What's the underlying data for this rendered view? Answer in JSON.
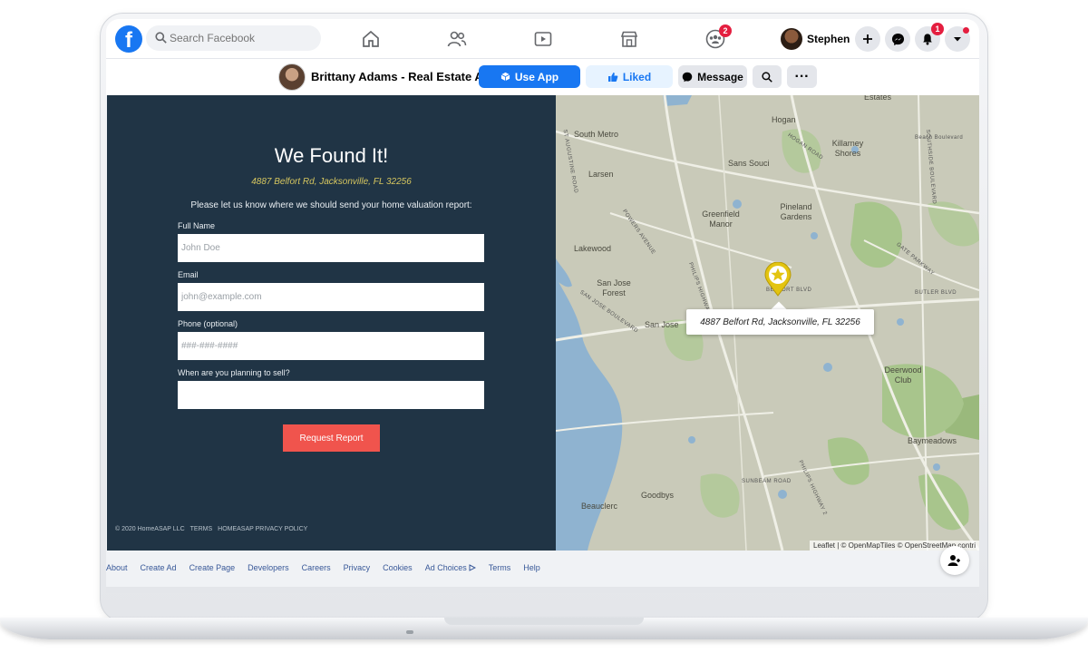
{
  "topnav": {
    "logo": "f",
    "search_placeholder": "Search Facebook",
    "groups_badge": "2",
    "user_name": "Stephen",
    "notifications_badge": "1",
    "brand_color": "#1877f2"
  },
  "page_header": {
    "page_name": "Brittany Adams - Real Estate A...",
    "use_app_label": "Use App",
    "liked_label": "Liked",
    "message_label": "Message",
    "more_label": "···"
  },
  "form": {
    "title": "We Found It!",
    "address": "4887 Belfort Rd, Jacksonville, FL 32256",
    "prompt": "Please let us know where we should send your home valuation report:",
    "fields": [
      {
        "label": "Full Name",
        "placeholder": "John Doe"
      },
      {
        "label": "Email",
        "placeholder": "john@example.com"
      },
      {
        "label": "Phone (optional)",
        "placeholder": "###-###-####"
      },
      {
        "label": "When are you planning to sell?",
        "placeholder": ""
      }
    ],
    "submit_label": "Request Report",
    "footer": {
      "copyright": "© 2020 HomeASAP LLC",
      "terms": "TERMS",
      "privacy": "HOMEASAP PRIVACY POLICY"
    },
    "background_color": "#203445",
    "accent_color": "#f0544d"
  },
  "map": {
    "popup_address": "4887 Belfort Rd, Jacksonville, FL 32256",
    "attribution": "Leaflet | © OpenMapTiles © OpenStreetMap contri",
    "places": [
      "South Metro",
      "Hogan",
      "Killarney Shores",
      "Larsen",
      "Sans Souci",
      "Greenfield Manor",
      "Pineland Gardens",
      "Lakewood",
      "San Jose Forest",
      "San Jose",
      "Deerwood Club",
      "Baymeadows",
      "Goodbys",
      "Beauclerc",
      "Estates",
      "Beach Boulevard"
    ],
    "roads": [
      "HOGAN ROAD",
      "ST AUGUSTINE ROAD",
      "POWERS AVENUE",
      "PHILIPS HIGHWAY",
      "SAN JOSE BOULEVARD",
      "BELFORT BLVD",
      "GATE PARKWAY",
      "BUTLER BLVD",
      "SUNBEAM ROAD",
      "SOUTHSIDE BOULEVARD",
      "PHILIPS HIGHWAY 2"
    ]
  },
  "footer_links": [
    "About",
    "Create Ad",
    "Create Page",
    "Developers",
    "Careers",
    "Privacy",
    "Cookies",
    "Ad Choices",
    "Terms",
    "Help"
  ]
}
